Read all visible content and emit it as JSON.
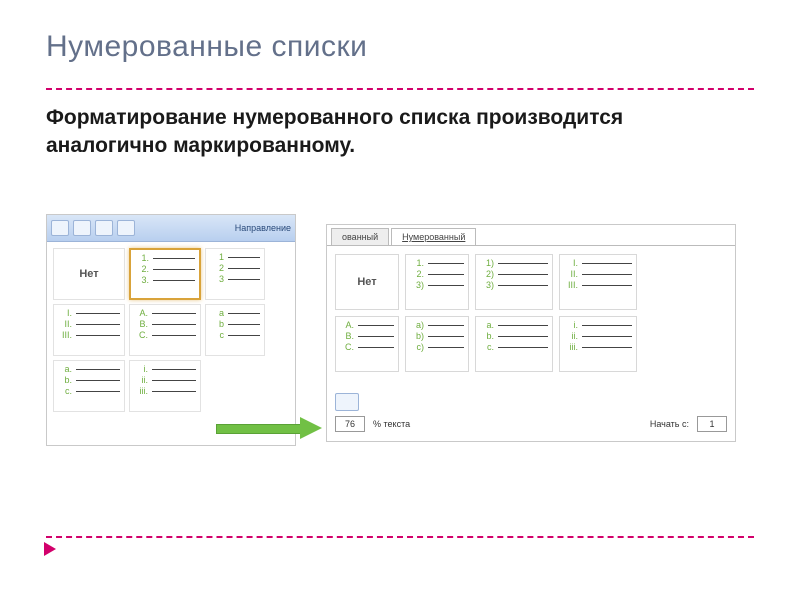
{
  "title": "Нумерованные списки",
  "body": "Форматирование нумерованного списка производится аналогично маркированному.",
  "ribbon_label": "Направление",
  "none_label": "Нет",
  "left_cells": {
    "r0c1": [
      "1.",
      "2.",
      "3."
    ],
    "r0c2": [
      "1",
      "2",
      "3"
    ],
    "r1c0": [
      "I.",
      "II.",
      "III."
    ],
    "r1c1": [
      "A.",
      "B.",
      "C."
    ],
    "r1c2": [
      "a",
      "b",
      "c"
    ],
    "r2c0": [
      "a.",
      "b.",
      "c."
    ],
    "r2c1": [
      "i.",
      "ii.",
      "iii."
    ]
  },
  "tabs": {
    "left": "ованный",
    "right": "Нумерованный"
  },
  "right_cells": {
    "r0c1": [
      "1.",
      "2.",
      "3)"
    ],
    "r0c2": [
      "1)",
      "2)",
      "3)"
    ],
    "r0c3": [
      "I.",
      "II.",
      "III."
    ],
    "r1c0": [
      "A.",
      "B.",
      "C."
    ],
    "r1c1": [
      "a)",
      "b)",
      "c)"
    ],
    "r1c2": [
      "a.",
      "b.",
      "c."
    ],
    "r1c3": [
      "i.",
      "ii.",
      "iii."
    ]
  },
  "dialog_bottom": {
    "percent_value": "76",
    "percent_label": "% текста",
    "start_label": "Начать с:",
    "start_value": "1"
  }
}
